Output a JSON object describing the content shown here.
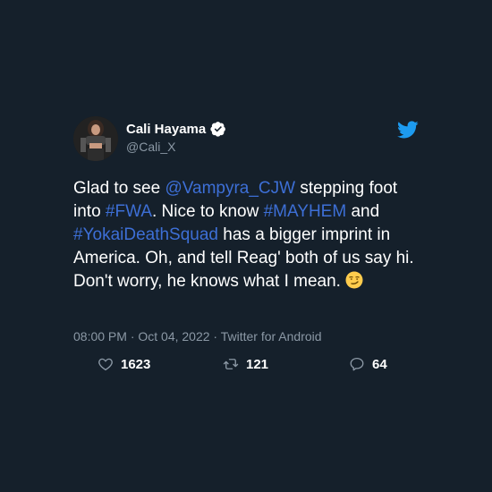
{
  "tweet": {
    "display_name": "Cali Hayama",
    "handle": "@Cali_X",
    "body": {
      "t1": "Glad to see ",
      "mention": "@Vampyra_CJW",
      "t2": " stepping foot into ",
      "tag1": "#FWA",
      "t3": ". Nice to know ",
      "tag2": "#MAYHEM",
      "t4": " and ",
      "tag3": "#YokaiDeathSquad",
      "t5": " has a bigger imprint in America. Oh, and tell Reag' both of us say hi. Don't worry, he knows what I mean. "
    },
    "meta": "08:00 PM · Oct 04, 2022 · Twitter for Android",
    "likes": "1623",
    "retweets": "121",
    "replies": "64"
  },
  "colors": {
    "background": "#15202b",
    "link": "#3d6fd6",
    "muted": "#8b98a5",
    "twitter_blue": "#1d9bf0"
  },
  "icons": [
    "verified-badge-icon",
    "twitter-bird-icon",
    "heart-icon",
    "retweet-icon",
    "reply-icon",
    "smirk-emoji-icon"
  ]
}
